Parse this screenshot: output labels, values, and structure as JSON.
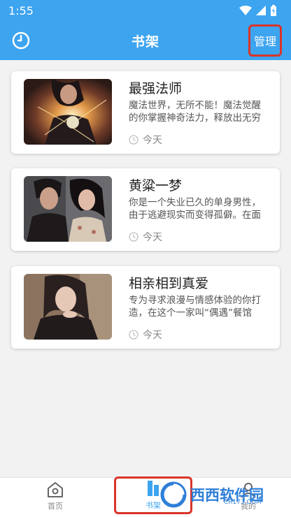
{
  "status_bar": {
    "time": "1:55"
  },
  "header": {
    "title": "书架",
    "history_icon": "clock-icon",
    "manage_label": "管理"
  },
  "books": [
    {
      "title": "最强法师",
      "description": "魔法世界，无所不能！魔法觉醒的你掌握神奇法力，释放出无穷",
      "time": "今天"
    },
    {
      "title": "黄粱一梦",
      "description": "你是一个失业已久的单身男性，由于逃避现实而变得孤僻。在面",
      "time": "今天"
    },
    {
      "title": "相亲相到真爱",
      "description": "专为寻求浪漫与情感体验的你打造，在这个一家叫“偶遇”餐馆",
      "time": "今天"
    }
  ],
  "bottom_nav": {
    "home_label": "首页",
    "shelf_label": "书架",
    "mine_label": "我的"
  },
  "watermark": {
    "text": "西西软件园",
    "sub": "CR173.COM"
  },
  "colors": {
    "primary": "#3da4f0",
    "highlight": "#d9352b",
    "background": "#f2f2f2"
  }
}
